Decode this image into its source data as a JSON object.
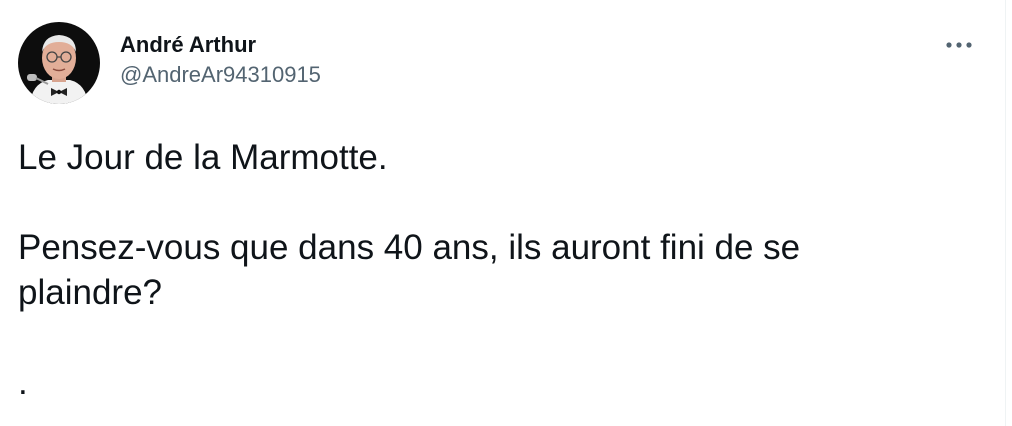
{
  "tweet": {
    "author": {
      "display_name": "André Arthur",
      "handle": "@AndreAr94310915"
    },
    "more_icon": "more-horizontal-icon",
    "text_lines": [
      "Le Jour de la Marmotte.",
      "Pensez-vous que dans 40 ans, ils auront fini de se",
      "plaindre?",
      "."
    ]
  }
}
